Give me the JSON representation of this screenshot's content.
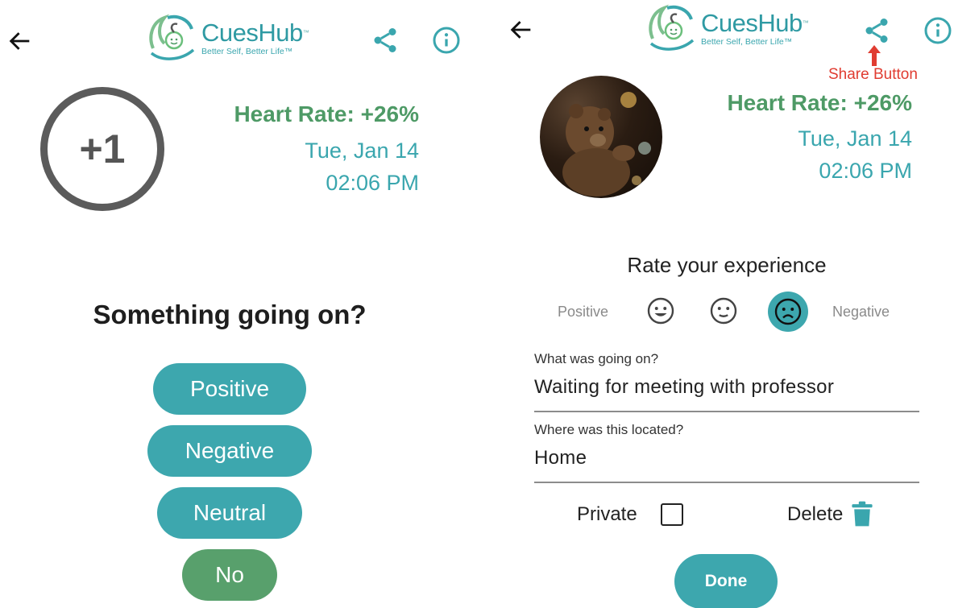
{
  "brand": {
    "name": "CuesHub",
    "trademark": "™",
    "tagline": "Better Self, Better Life™"
  },
  "left_screen": {
    "score": "+1",
    "heart_rate": "Heart Rate: +26%",
    "date": "Tue, Jan 14",
    "time": "02:06 PM",
    "question": "Something going on?",
    "options": [
      {
        "label": "Positive"
      },
      {
        "label": "Negative"
      },
      {
        "label": "Neutral"
      },
      {
        "label": "No"
      }
    ]
  },
  "right_screen": {
    "heart_rate": "Heart Rate: +26%",
    "date": "Tue, Jan 14",
    "time": "02:06 PM",
    "annotation": "Share Button",
    "rate_title": "Rate your experience",
    "scale_left": "Positive",
    "scale_right": "Negative",
    "selected_rating": "negative",
    "what_label": "What was going on?",
    "what_value": "Waiting for meeting with professor",
    "where_label": "Where was this located?",
    "where_value": "Home",
    "private_label": "Private",
    "private_checked": false,
    "delete_label": "Delete",
    "done_label": "Done"
  },
  "colors": {
    "teal": "#3da7ae",
    "green": "#4e9a66",
    "annotation_red": "#e03c31"
  },
  "icons": [
    "back-arrow-icon",
    "share-icon",
    "info-icon",
    "smile-icon",
    "neutral-face-icon",
    "sad-face-icon",
    "trash-icon",
    "arrow-up-icon"
  ]
}
